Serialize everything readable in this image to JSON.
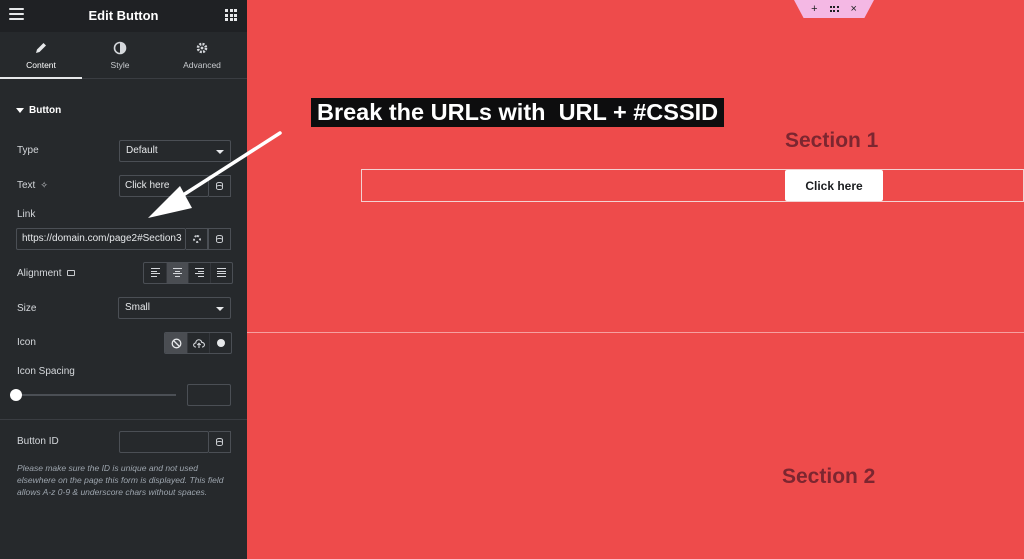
{
  "panel": {
    "title": "Edit Button",
    "tabs": [
      {
        "label": "Content",
        "icon": "pencil-icon",
        "active": true
      },
      {
        "label": "Style",
        "icon": "contrast-icon",
        "active": false
      },
      {
        "label": "Advanced",
        "icon": "gear-icon",
        "active": false
      }
    ],
    "section_label": "Button",
    "controls": {
      "type": {
        "label": "Type",
        "value": "Default"
      },
      "text": {
        "label": "Text",
        "value": "Click here"
      },
      "link": {
        "label": "Link",
        "value": "https://domain.com/page2#Section3"
      },
      "alignment": {
        "label": "Alignment",
        "options": [
          "left",
          "center",
          "right",
          "justify"
        ],
        "selected": "center"
      },
      "size": {
        "label": "Size",
        "value": "Small"
      },
      "icon": {
        "label": "Icon",
        "options": [
          "none",
          "upload",
          "custom"
        ],
        "selected": "none"
      },
      "icon_spacing": {
        "label": "Icon Spacing",
        "value": 0
      },
      "button_id": {
        "label": "Button ID",
        "value": ""
      }
    },
    "help_text": "Please make sure the ID is unique and not used elsewhere on the page this form is displayed. This field allows A-z  0-9 & underscore chars without spaces."
  },
  "canvas": {
    "annotation": "Break the URLs with  URL + #CSSID",
    "section1_title": "Section 1",
    "section2_title": "Section 2",
    "button_label": "Click here",
    "toolbar": {
      "add": "+",
      "close": "×"
    }
  },
  "colors": {
    "panel_bg": "#26292c",
    "canvas_bg": "#ee4b4b",
    "section_title": "#7c2630"
  }
}
